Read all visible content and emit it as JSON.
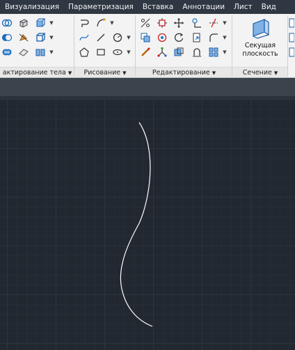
{
  "menu": {
    "items": [
      "Визуализация",
      "Параметризация",
      "Вставка",
      "Аннотации",
      "Лист",
      "Вид"
    ]
  },
  "ribbon": {
    "panels": [
      {
        "label": "актирование тела"
      },
      {
        "label": "Рисование"
      },
      {
        "label": "Редактирование"
      },
      {
        "label": "Сечение"
      }
    ],
    "section_plane": {
      "label_line1": "Секущая",
      "label_line2": "плоскость"
    },
    "dropdown_glyph": "▼"
  },
  "drawing": {
    "curve_color": "#ffffff"
  }
}
